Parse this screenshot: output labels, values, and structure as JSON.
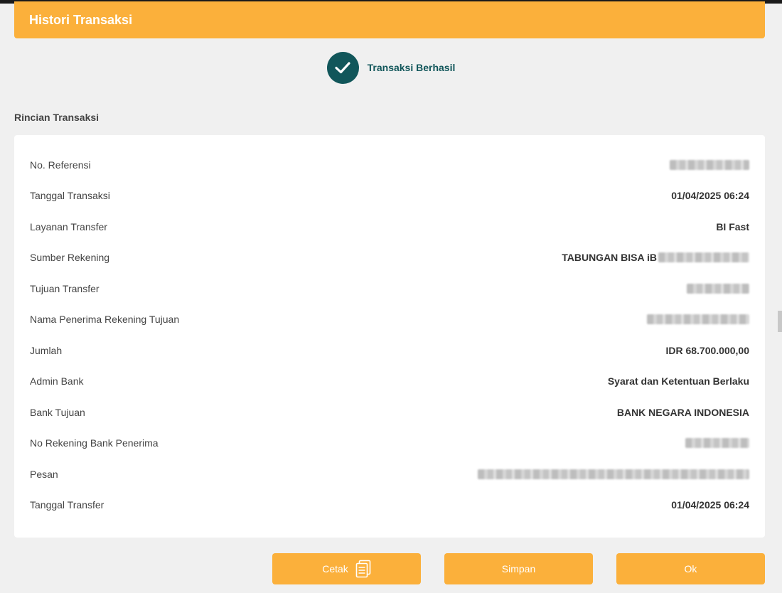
{
  "header": {
    "title": "Histori Transaksi"
  },
  "status": {
    "text": "Transaksi Berhasil",
    "icon": "check-icon"
  },
  "section": {
    "title": "Rincian Transaksi"
  },
  "details": [
    {
      "label": "No. Referensi",
      "value": "",
      "blurred": true,
      "blur_width": 112
    },
    {
      "label": "Tanggal Transaksi",
      "value": "01/04/2025 06:24"
    },
    {
      "label": "Layanan Transfer",
      "value": "BI Fast"
    },
    {
      "label": "Sumber Rekening",
      "value": "TABUNGAN BISA iB",
      "blurred": true,
      "blur_width": 128
    },
    {
      "label": "Tujuan Transfer",
      "value": "",
      "blurred": true,
      "blur_width": 88
    },
    {
      "label": "Nama Penerima Rekening Tujuan",
      "value": "",
      "blurred": true,
      "blur_width": 144
    },
    {
      "label": "Jumlah",
      "value": "IDR 68.700.000,00"
    },
    {
      "label": "Admin Bank",
      "value": "Syarat dan Ketentuan Berlaku"
    },
    {
      "label": "Bank Tujuan",
      "value": "BANK NEGARA INDONESIA"
    },
    {
      "label": "No Rekening Bank Penerima",
      "value": "",
      "blurred": true,
      "blur_width": 90
    },
    {
      "label": "Pesan",
      "value": "",
      "blurred": true,
      "blur_width": 382
    },
    {
      "label": "Tanggal Transfer",
      "value": "01/04/2025 06:24"
    }
  ],
  "buttons": {
    "print_label": "Cetak",
    "print_icon": "document-icon",
    "save_label": "Simpan",
    "ok_label": "Ok"
  },
  "colors": {
    "accent": "#fbb03b",
    "status": "#11565a",
    "background": "#f0f0f0"
  }
}
